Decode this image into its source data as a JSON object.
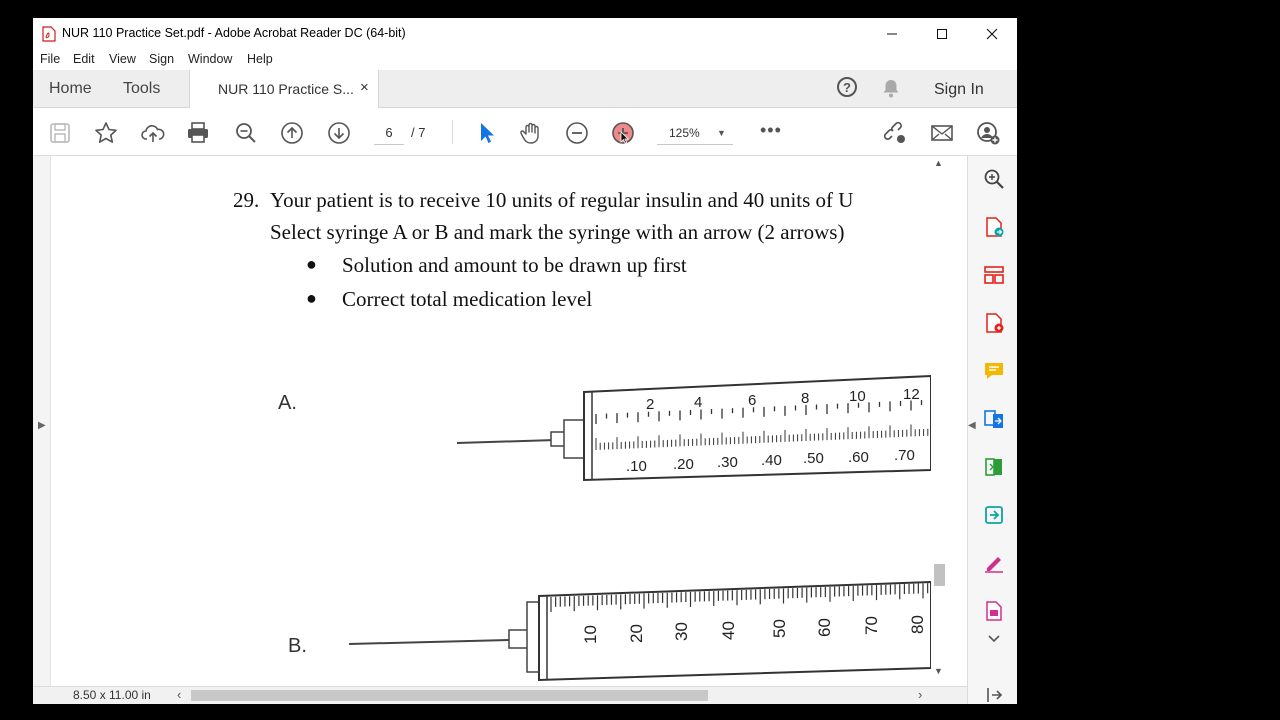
{
  "window": {
    "title": "NUR 110 Practice Set.pdf - Adobe Acrobat Reader DC (64-bit)"
  },
  "menu": [
    "File",
    "Edit",
    "View",
    "Sign",
    "Window",
    "Help"
  ],
  "tabs": {
    "home": "Home",
    "tools": "Tools",
    "doc": "NUR 110 Practice S...",
    "close": "×"
  },
  "header_right": {
    "help": "?",
    "signin": "Sign In"
  },
  "toolbar": {
    "page_current": "6",
    "page_total": "/ 7",
    "zoom": "125%",
    "more": "•••"
  },
  "document": {
    "q_number": "29.",
    "line1": "Your patient is to receive 10 units of regular insulin and 40 units of U",
    "line2": "Select syringe A or B and mark the syringe with an arrow (2 arrows)",
    "bullets": [
      "Solution and amount to be drawn up first",
      "Correct total medication level"
    ],
    "syringe_a": {
      "label": "A.",
      "top_scale": [
        "2",
        "4",
        "6",
        "8",
        "10",
        "12"
      ],
      "bottom_scale": [
        ".10",
        ".20",
        ".30",
        ".40",
        ".50",
        ".60",
        ".70"
      ]
    },
    "syringe_b": {
      "label": "B.",
      "scale": [
        "10",
        "20",
        "30",
        "40",
        "50",
        "60",
        "70",
        "80"
      ]
    }
  },
  "status": {
    "page_size": "8.50 x 11.00 in"
  },
  "colors": {
    "accent_blue": "#1473e6",
    "pane_icon_red": "#e1251b",
    "pane_icon_teal": "#0aa5a3"
  }
}
